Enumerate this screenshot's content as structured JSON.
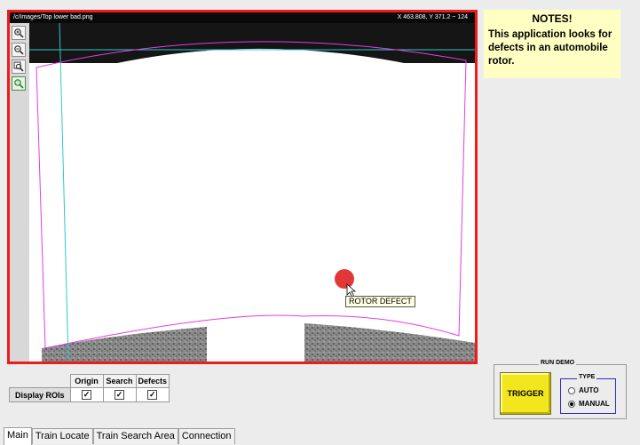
{
  "viewer": {
    "file_path": "/c/Images/Top lower bad.png",
    "coords": "X 463.808,  Y 371.2  ~ 124",
    "defect_label": "ROTOR DEFECT",
    "tools": [
      "zoom-in-icon",
      "zoom-out-icon",
      "zoom-fit-icon",
      "pan-icon"
    ]
  },
  "notes": {
    "title": "NOTES!",
    "text": "This application looks for defects in an automobile rotor."
  },
  "roi": {
    "button_label": "Display ROIs",
    "columns": [
      "Origin",
      "Search",
      "Defects"
    ],
    "checked": [
      true,
      true,
      true
    ],
    "check_mark": "✓"
  },
  "run_demo": {
    "title": "RUN DEMO",
    "trigger_label": "TRIGGER",
    "type_title": "TYPE",
    "options": [
      "AUTO",
      "MANUAL"
    ],
    "selected": "MANUAL"
  },
  "tabs": [
    "Main",
    "Train Locate",
    "Train Search Area",
    "Connection"
  ],
  "colors": {
    "viewer_border": "#ee1c1c",
    "search_roi": "#e040e0",
    "origin_roi": "#2fc6d0",
    "defect": "#e02020",
    "notes_bg": "#ffffc4",
    "trigger_bg": "#f1e71c"
  }
}
